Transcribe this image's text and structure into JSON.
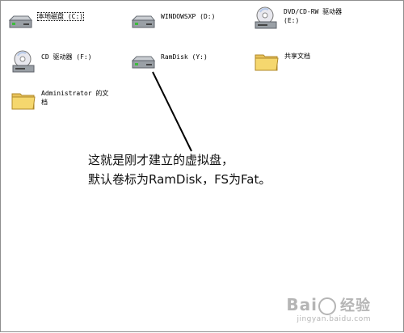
{
  "items": [
    {
      "id": "c",
      "label": "本地磁盘 (C:)",
      "icon": "hard-drive-icon"
    },
    {
      "id": "d",
      "label": "WINDOWSXP (D:)",
      "icon": "hard-drive-icon"
    },
    {
      "id": "e",
      "label": "DVD/CD-RW 驱动器 (E:)",
      "icon": "dvd-drive-icon"
    },
    {
      "id": "f",
      "label": "CD 驱动器 (F:)",
      "icon": "cd-drive-icon"
    },
    {
      "id": "y",
      "label": "RamDisk (Y:)",
      "icon": "hard-drive-icon"
    },
    {
      "id": "share",
      "label": "共享文档",
      "icon": "folder-icon"
    },
    {
      "id": "admin",
      "label": "Administrator 的文档",
      "icon": "folder-icon"
    }
  ],
  "annotation": {
    "line1": "这就是刚才建立的虚拟盘，",
    "line2": "默认卷标为RamDisk，FS为Fat。"
  },
  "watermark": {
    "logo_left": "Bai",
    "logo_right": "经验",
    "url": "jingyan.baidu.com"
  },
  "colors": {
    "folder": "#f5d76e",
    "drive_body": "#9aa0a6",
    "annotation_line": "#000000"
  }
}
